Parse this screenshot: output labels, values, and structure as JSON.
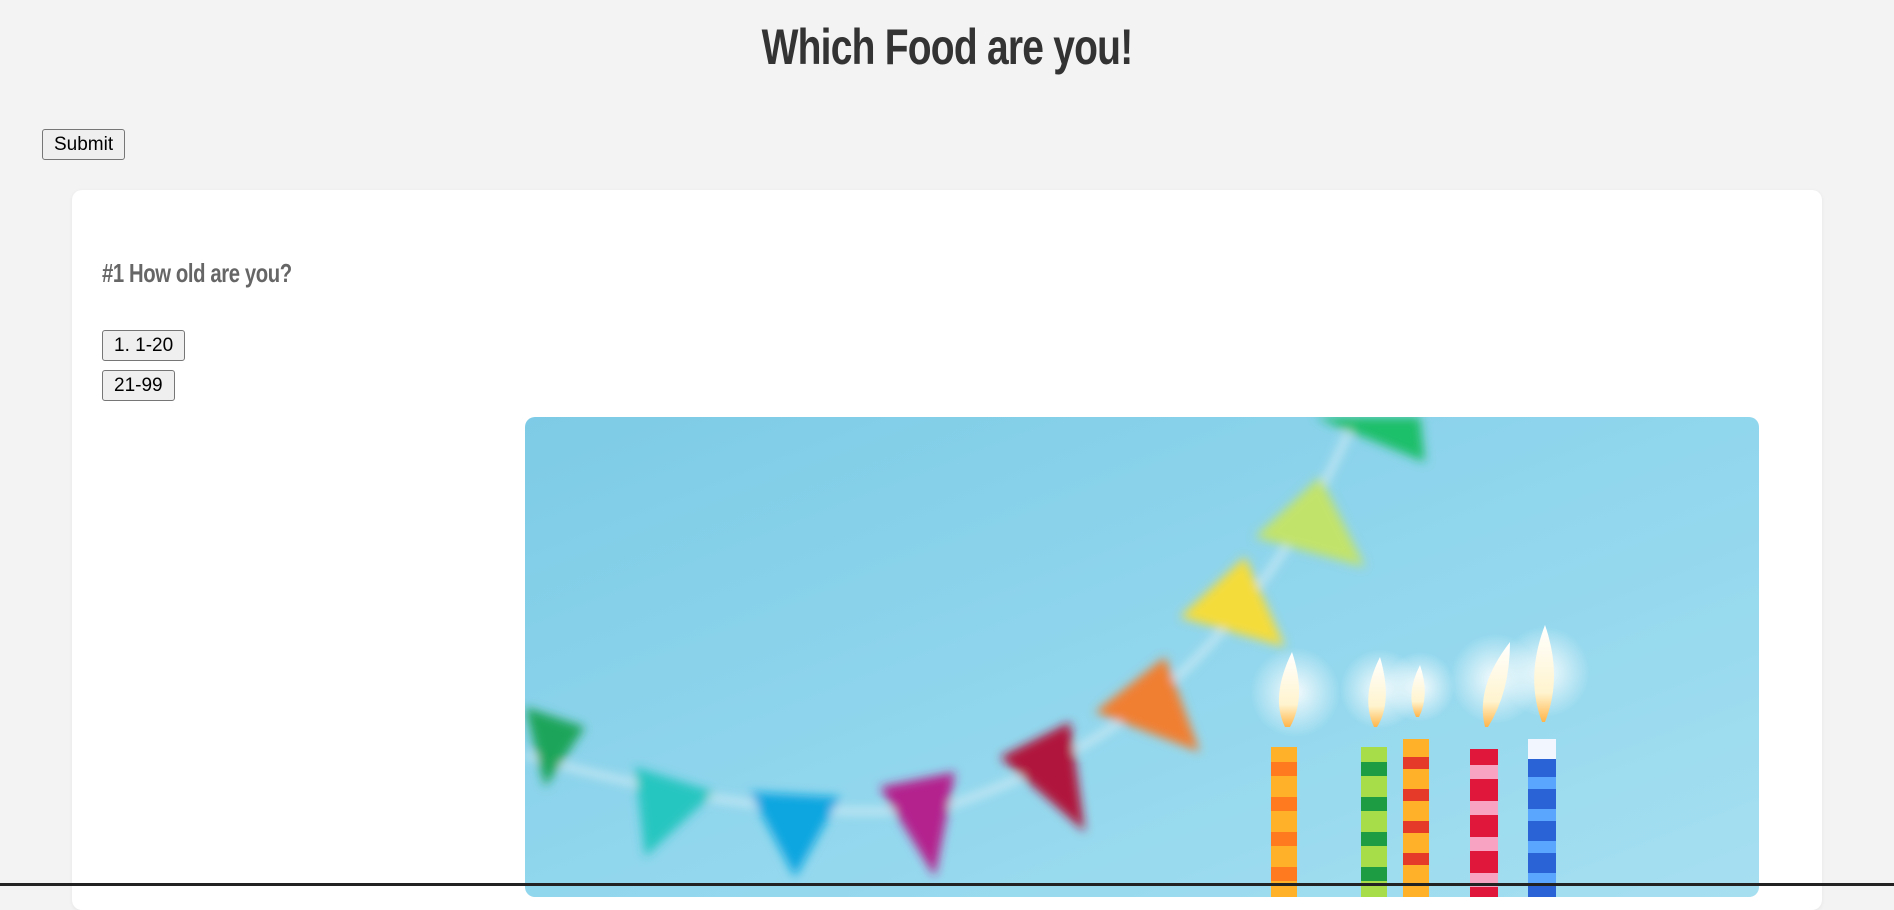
{
  "header": {
    "title": "Which Food are you!"
  },
  "form": {
    "submit_label": "Submit"
  },
  "quiz": {
    "question": "#1 How old are you?",
    "options": [
      "1. 1-20",
      "21-99"
    ],
    "image": {
      "subject": "birthday-candles-and-bunting",
      "colors": {
        "sky": "#86d3ec",
        "flame": "#fff3c8"
      }
    }
  }
}
